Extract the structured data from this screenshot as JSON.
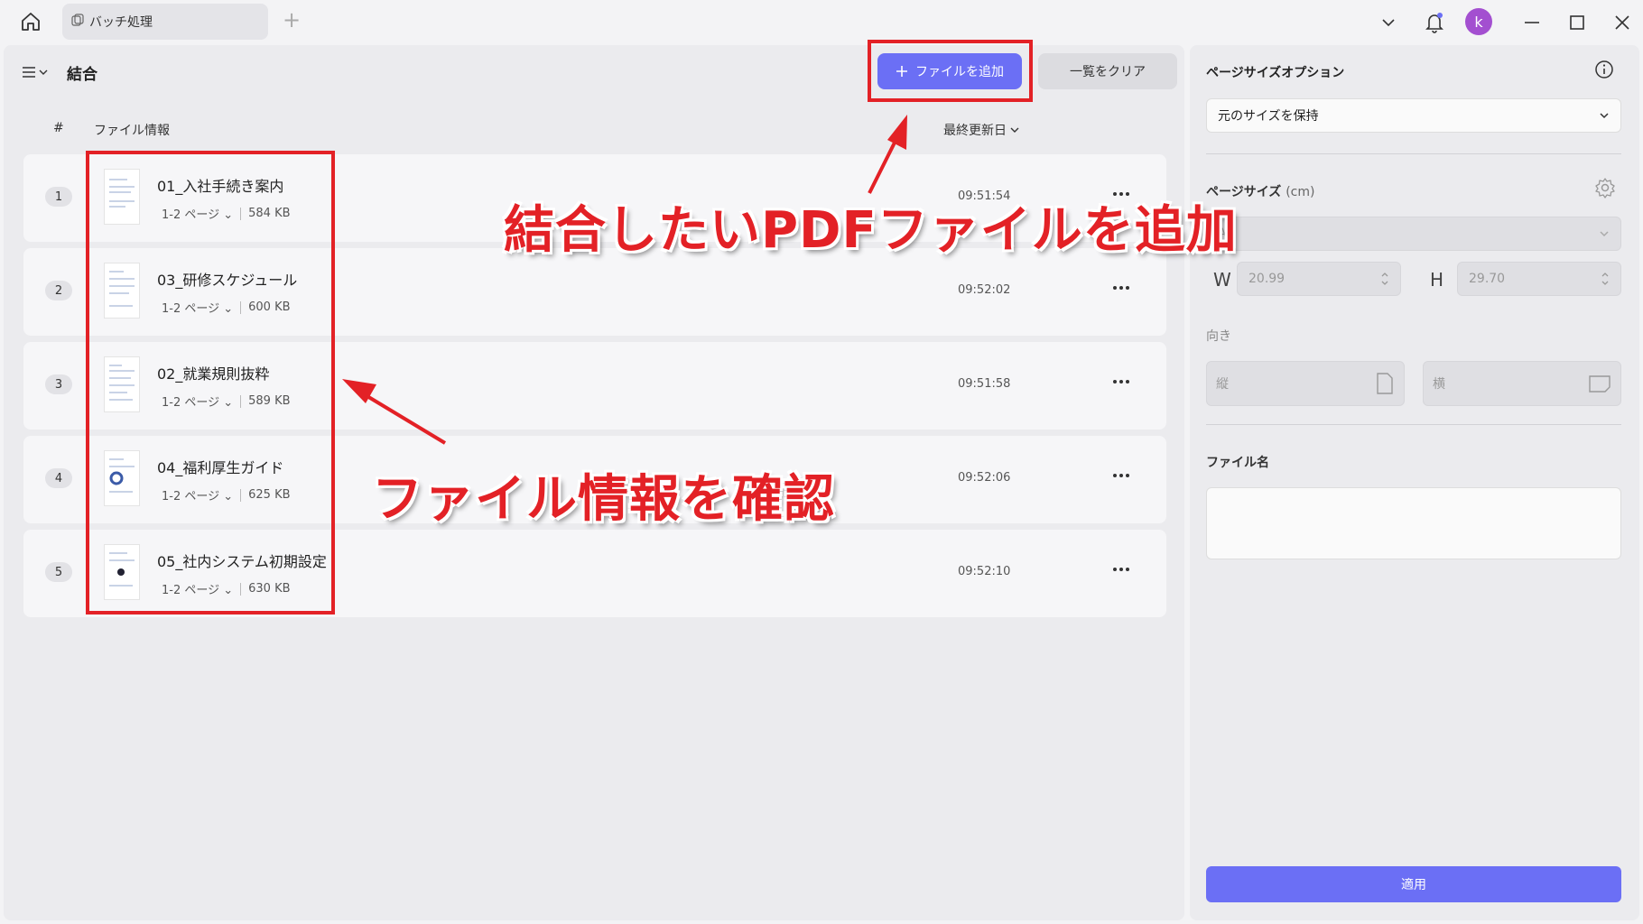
{
  "titlebar": {
    "tab_label": "バッチ処理",
    "avatar_letter": "k"
  },
  "toolbar": {
    "mode_title": "結合",
    "add_file_label": "ファイルを追加",
    "clear_list_label": "一覧をクリア"
  },
  "table": {
    "col_number": "#",
    "col_file_info": "ファイル情報",
    "col_last_modified": "最終更新日"
  },
  "files": [
    {
      "num": "1",
      "name": "01_入社手続き案内",
      "pages": "1-2 ページ",
      "size": "584 KB",
      "time": "09:51:54"
    },
    {
      "num": "2",
      "name": "03_研修スケジュール",
      "pages": "1-2 ページ",
      "size": "600 KB",
      "time": "09:52:02"
    },
    {
      "num": "3",
      "name": "02_就業規則抜粋",
      "pages": "1-2 ページ",
      "size": "589 KB",
      "time": "09:51:58"
    },
    {
      "num": "4",
      "name": "04_福利厚生ガイド",
      "pages": "1-2 ページ",
      "size": "625 KB",
      "time": "09:52:06"
    },
    {
      "num": "5",
      "name": "05_社内システム初期設定",
      "pages": "1-2 ページ",
      "size": "630 KB",
      "time": "09:52:10"
    }
  ],
  "side": {
    "page_size_option_title": "ページサイズオプション",
    "page_size_option_value": "元のサイズを保持",
    "page_size_label": "ページサイズ",
    "page_size_unit": "(cm)",
    "paper_value": "A4",
    "width_letter": "W",
    "width_value": "20.99",
    "height_letter": "H",
    "height_value": "29.70",
    "orientation_label": "向き",
    "portrait_label": "縦",
    "landscape_label": "横",
    "filename_label": "ファイル名",
    "apply_label": "適用"
  },
  "annotations": {
    "add_pdf_text": "結合したいPDFファイルを追加",
    "check_info_text": "ファイル情報を確認",
    "color": "#e32126"
  },
  "colors": {
    "accent": "#6b6ff5",
    "avatar": "#a34fd0"
  }
}
